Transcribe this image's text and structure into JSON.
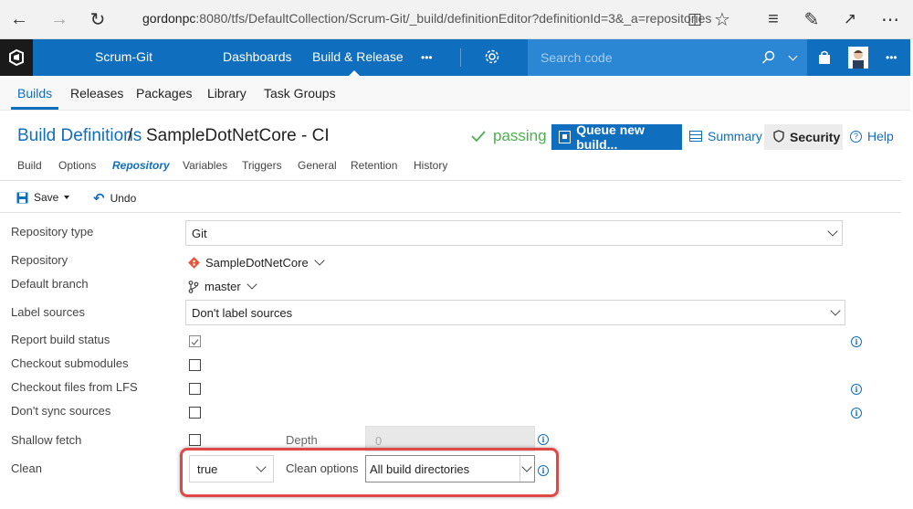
{
  "browser": {
    "url_host": "gordonpc",
    "url_rest": ":8080/tfs/DefaultCollection/Scrum-Git/_build/definitionEditor?definitionId=3&_a=repositories"
  },
  "topnav": {
    "project": "Scrum-Git",
    "tabs": [
      "Dashboards",
      "Build & Release"
    ],
    "more": "•••",
    "search_placeholder": "Search code"
  },
  "hubs": [
    "Builds",
    "Releases",
    "Packages",
    "Library",
    "Task Groups"
  ],
  "header": {
    "breadcrumb": "Build Definitions",
    "breadcrumb_sep": "/",
    "title": "SampleDotNetCore - CI",
    "status": "passing",
    "queue_label": "Queue new build...",
    "summary_label": "Summary",
    "security_label": "Security",
    "help_label": "Help"
  },
  "subtabs": [
    "Build",
    "Options",
    "Repository",
    "Variables",
    "Triggers",
    "General",
    "Retention",
    "History"
  ],
  "toolbar": {
    "save": "Save",
    "undo": "Undo"
  },
  "form": {
    "repository_type": {
      "label": "Repository type",
      "value": "Git"
    },
    "repository": {
      "label": "Repository",
      "value": "SampleDotNetCore"
    },
    "default_branch": {
      "label": "Default branch",
      "value": "master"
    },
    "label_sources": {
      "label": "Label sources",
      "value": "Don't label sources"
    },
    "report_build_status": {
      "label": "Report build status",
      "checked": true
    },
    "checkout_submodules": {
      "label": "Checkout submodules",
      "checked": false
    },
    "checkout_lfs": {
      "label": "Checkout files from LFS",
      "checked": false
    },
    "dont_sync": {
      "label": "Don't sync sources",
      "checked": false
    },
    "shallow_fetch": {
      "label": "Shallow fetch",
      "checked": false,
      "depth_label": "Depth",
      "depth_value": "0"
    },
    "clean": {
      "label": "Clean",
      "value": "true",
      "options_label": "Clean options",
      "options_value": "All build directories"
    }
  },
  "colors": {
    "accent": "#106ebe",
    "passing": "#4caf50",
    "highlight": "#e04848"
  }
}
